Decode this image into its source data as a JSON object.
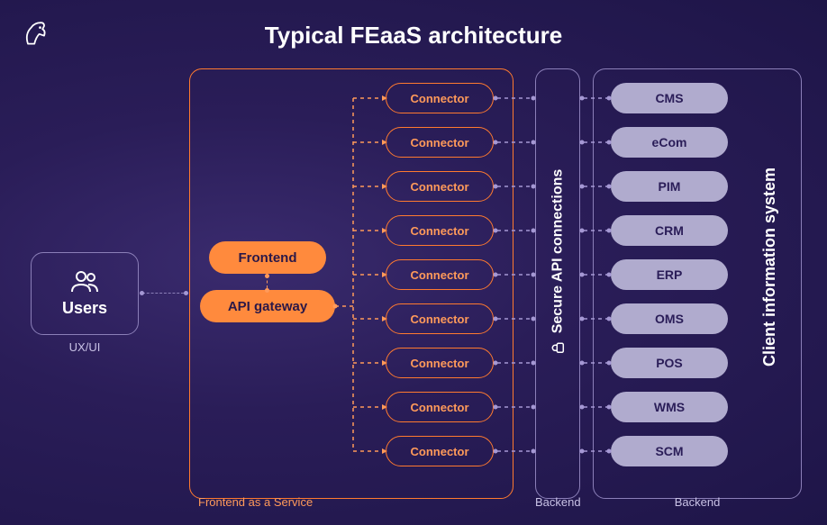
{
  "title": "Typical FEaaS architecture",
  "logo_name": "horse-head-logo",
  "users": {
    "icon": "users-icon",
    "label": "Users",
    "sublabel": "UX/UI"
  },
  "feaas": {
    "frontend_label": "Frontend",
    "gateway_label": "API gateway",
    "box_label": "Frontend as a Service",
    "connectors": [
      "Connector",
      "Connector",
      "Connector",
      "Connector",
      "Connector",
      "Connector",
      "Connector",
      "Connector",
      "Connector"
    ]
  },
  "backend1": {
    "lock_icon": "lock-icon",
    "label": "Secure API connections",
    "box_label": "Backend"
  },
  "backend2": {
    "label": "Client information system",
    "box_label": "Backend",
    "systems": [
      "CMS",
      "eCom",
      "PIM",
      "CRM",
      "ERP",
      "OMS",
      "POS",
      "WMS",
      "SCM"
    ]
  },
  "colors": {
    "orange": "#ff8a3d",
    "orange_border": "#ff7a2f",
    "purple_border": "#8b7fb8",
    "pill_bg": "#b0abce"
  }
}
